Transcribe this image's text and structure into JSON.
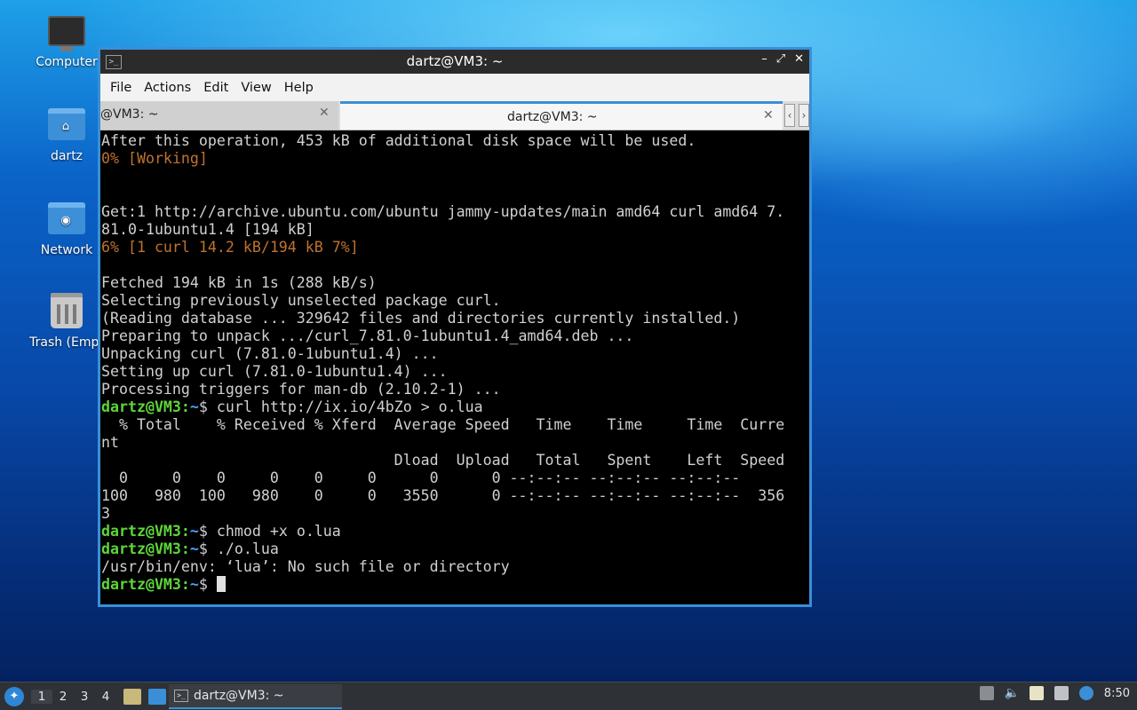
{
  "desktop": {
    "icons": [
      {
        "label": "Computer"
      },
      {
        "label": "dartz"
      },
      {
        "label": "Network"
      },
      {
        "label": "Trash (Empt"
      }
    ]
  },
  "window": {
    "title": "dartz@VM3: ~",
    "controls": {
      "minimize": "–",
      "maximize": "⤢",
      "close": "✕"
    },
    "menu": [
      "File",
      "Actions",
      "Edit",
      "View",
      "Help"
    ],
    "tabs": [
      {
        "label": "@VM3: ~",
        "close": "✕",
        "active": false
      },
      {
        "label": "dartz@VM3: ~",
        "close": "✕",
        "active": true
      }
    ],
    "tab_nav": {
      "prev": "‹",
      "next": "›"
    }
  },
  "terminal": {
    "l1": "After this operation, 453 kB of additional disk space will be used.",
    "l2": "0% [Working]",
    "l3": "",
    "l4": "",
    "l5": "Get:1 http://archive.ubuntu.com/ubuntu jammy-updates/main amd64 curl amd64 7.",
    "l6": "81.0-1ubuntu1.4 [194 kB]",
    "l7": "6% [1 curl 14.2 kB/194 kB 7%]",
    "l8": "",
    "l9": "Fetched 194 kB in 1s (288 kB/s)",
    "l10": "Selecting previously unselected package curl.",
    "l11": "(Reading database ... 329642 files and directories currently installed.)",
    "l12": "Preparing to unpack .../curl_7.81.0-1ubuntu1.4_amd64.deb ...",
    "l13": "Unpacking curl (7.81.0-1ubuntu1.4) ...",
    "l14": "Setting up curl (7.81.0-1ubuntu1.4) ...",
    "l15": "Processing triggers for man-db (2.10.2-1) ...",
    "prompt_user": "dartz@VM3",
    "prompt_sep": ":",
    "prompt_path": "~",
    "prompt_dollar": "$",
    "cmd1": " curl http://ix.io/4bZo > o.lua",
    "l17": "  % Total    % Received % Xferd  Average Speed   Time    Time     Time  Curre",
    "l18": "nt",
    "l19": "                                 Dload  Upload   Total   Spent    Left  Speed",
    "l20": "  0     0    0     0    0     0      0      0 --:--:-- --:--:-- --:--:--",
    "l21": "100   980  100   980    0     0   3550      0 --:--:-- --:--:-- --:--:--  356",
    "l22": "3",
    "cmd2": " chmod +x o.lua",
    "cmd3": " ./o.lua",
    "l25": "/usr/bin/env: ‘lua’: No such file or directory",
    "cmd4": " "
  },
  "taskbar": {
    "start_icon": "start-menu-icon",
    "workspaces": [
      "1",
      "2",
      "3",
      "4"
    ],
    "task_label": "dartz@VM3: ~",
    "clock": "8:50"
  },
  "colors": {
    "accent": "#3a8fd6",
    "prompt_green": "#5ed53a",
    "path_blue": "#4aa3ff",
    "progress_orange": "#c0722e"
  }
}
